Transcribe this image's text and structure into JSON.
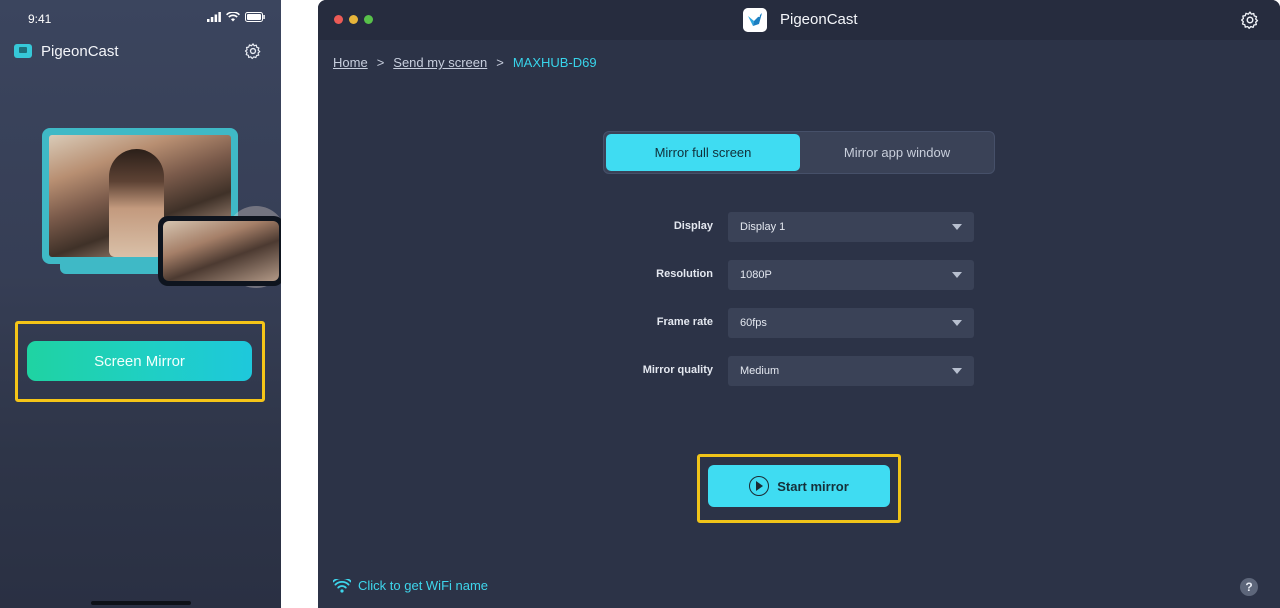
{
  "phone": {
    "status_time": "9:41",
    "app_title": "PigeonCast",
    "screen_mirror_label": "Screen Mirror"
  },
  "window": {
    "title": "PigeonCast",
    "breadcrumb": {
      "home": "Home",
      "sep1": ">",
      "send": "Send my screen",
      "sep2": ">",
      "current": "MAXHUB-D69"
    },
    "tabs": {
      "active": "Mirror full screen",
      "inactive": "Mirror app window"
    },
    "settings": [
      {
        "label": "Display",
        "value": "Display 1"
      },
      {
        "label": "Resolution",
        "value": "1080P"
      },
      {
        "label": "Frame rate",
        "value": "60fps"
      },
      {
        "label": "Mirror quality",
        "value": "Medium"
      }
    ],
    "start_label": "Start mirror",
    "wifi_label": "Click to get WiFi name",
    "help_symbol": "?"
  },
  "colors": {
    "accent": "#3fdcf2",
    "highlight": "#f5c518",
    "phone_button": "#1fd3a2",
    "window_bg": "#2c3347"
  },
  "icons": [
    "signal-icon",
    "wifi-icon",
    "battery-icon",
    "gear-icon",
    "play-icon",
    "help-icon",
    "app-logo-icon"
  ]
}
